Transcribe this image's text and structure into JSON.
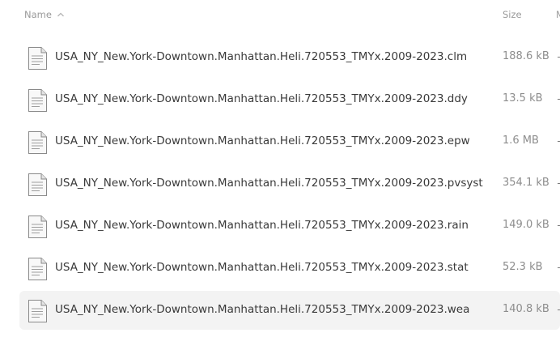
{
  "header": {
    "name_label": "Name",
    "size_label": "Size",
    "modified_label": "M"
  },
  "icons": {
    "sort": "sort-ascending-icon",
    "file": "text-file-icon"
  },
  "files": [
    {
      "name": "USA_NY_New.York-Downtown.Manhattan.Heli.720553_TMYx.2009-2023.clm",
      "size": "188.6 kB"
    },
    {
      "name": "USA_NY_New.York-Downtown.Manhattan.Heli.720553_TMYx.2009-2023.ddy",
      "size": "13.5 kB"
    },
    {
      "name": "USA_NY_New.York-Downtown.Manhattan.Heli.720553_TMYx.2009-2023.epw",
      "size": "1.6 MB"
    },
    {
      "name": "USA_NY_New.York-Downtown.Manhattan.Heli.720553_TMYx.2009-2023.pvsyst",
      "size": "354.1 kB"
    },
    {
      "name": "USA_NY_New.York-Downtown.Manhattan.Heli.720553_TMYx.2009-2023.rain",
      "size": "149.0 kB"
    },
    {
      "name": "USA_NY_New.York-Downtown.Manhattan.Heli.720553_TMYx.2009-2023.stat",
      "size": "52.3 kB"
    },
    {
      "name": "USA_NY_New.York-Downtown.Manhattan.Heli.720553_TMYx.2009-2023.wea",
      "size": "140.8 kB"
    }
  ]
}
